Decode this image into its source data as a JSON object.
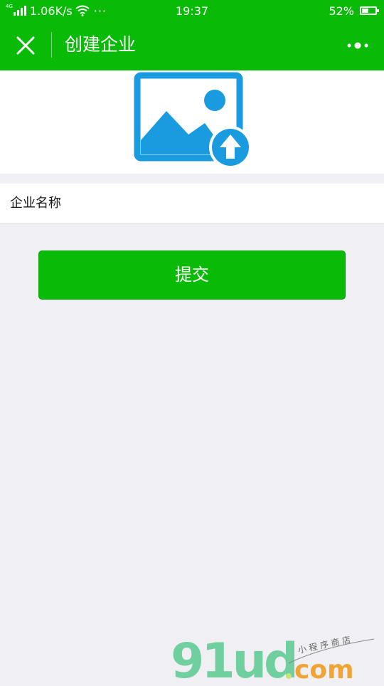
{
  "status_bar": {
    "network": "4G",
    "speed": "1.06K/s",
    "more": "···",
    "time": "19:37",
    "battery_percent": "52%",
    "battery_level": 0.52
  },
  "nav": {
    "title": "创建企业",
    "close_icon": "close-icon",
    "more_icon": "more-dots-icon"
  },
  "upload": {
    "icon": "image-upload-icon",
    "colors": {
      "primary": "#1a9be0",
      "arrow": "#ffffff"
    }
  },
  "form": {
    "company_name_label": "企业名称",
    "company_name_value": "",
    "company_name_placeholder": ""
  },
  "actions": {
    "submit_label": "提交"
  },
  "watermark": {
    "brand": "91ud",
    "domain": ".com",
    "tagline": "小程序商店"
  },
  "colors": {
    "accent": "#09bb07",
    "background": "#efeff4",
    "card": "#ffffff"
  }
}
